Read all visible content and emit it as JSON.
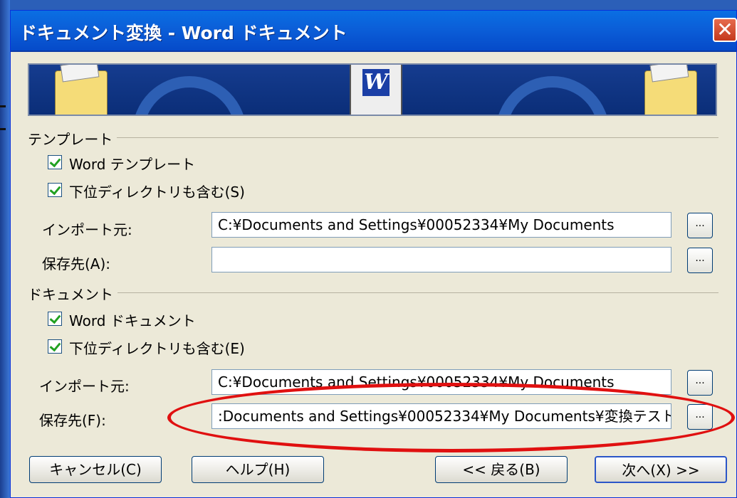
{
  "window": {
    "title": "ドキュメント変換 - Word ドキュメント",
    "close_label": "✕"
  },
  "templates": {
    "section_label": "テンプレート",
    "chk_word": "Word テンプレート",
    "chk_subdir": "下位ディレクトリも含む(S)",
    "import_label": "インポート元:",
    "import_value": "C:¥Documents and Settings¥00052334¥My Documents",
    "save_label": "保存先(A):",
    "save_value": "",
    "browse_label": "..."
  },
  "documents": {
    "section_label": "ドキュメント",
    "chk_word": "Word ドキュメント",
    "chk_subdir": "下位ディレクトリも含む(E)",
    "import_label": "インポート元:",
    "import_value": "C:¥Documents and Settings¥00052334¥My Documents",
    "save_label": "保存先(F):",
    "save_value": ":Documents and Settings¥00052334¥My Documents¥変換テスト",
    "browse_label": "..."
  },
  "buttons": {
    "cancel": "キャンセル(C)",
    "help": "ヘルプ(H)",
    "back": "<< 戻る(B)",
    "next": "次へ(X) >>"
  },
  "colors": {
    "titlebar": "#0b5ed8",
    "dialog": "#ece9d8",
    "highlight": "#e01010"
  }
}
